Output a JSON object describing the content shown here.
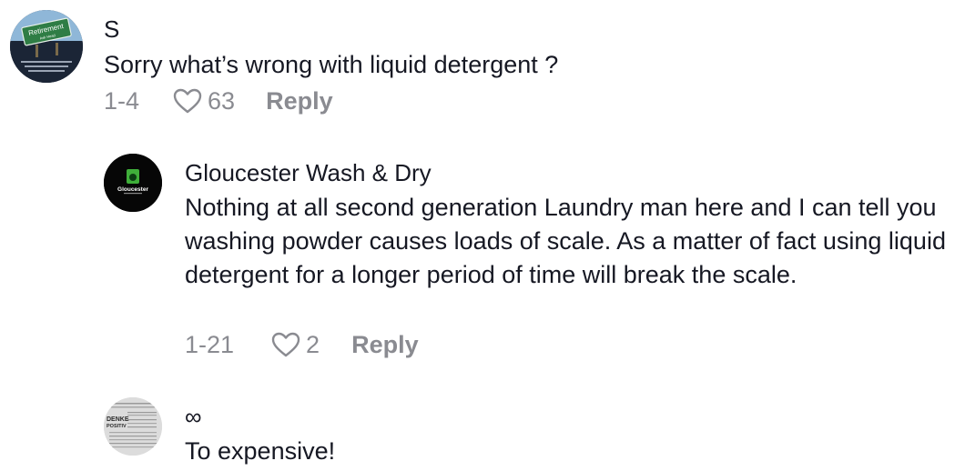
{
  "comments": [
    {
      "username": "S",
      "text": "Sorry what’s wrong with liquid detergent ?",
      "date": "1-4",
      "likes": "63",
      "reply_label": "Reply",
      "avatar_text": {
        "top": "Retirement",
        "sub": "Ask Head"
      }
    },
    {
      "username": "Gloucester Wash & Dry",
      "text": "Nothing at all second generation Laundry man here and I can tell you washing powder causes loads of scale. As a matter of fact using liquid detergent for a longer period of time will break the scale.",
      "date": "1-21",
      "likes": "2",
      "reply_label": "Reply",
      "avatar_text": {
        "name": "Gloucester"
      }
    },
    {
      "username": "∞",
      "text": "To expensive!",
      "avatar_text": {
        "top": "DENKE",
        "sub": "POSITIV"
      }
    }
  ],
  "colors": {
    "text": "#161823",
    "secondary": "#8a8b91",
    "background": "#ffffff"
  }
}
